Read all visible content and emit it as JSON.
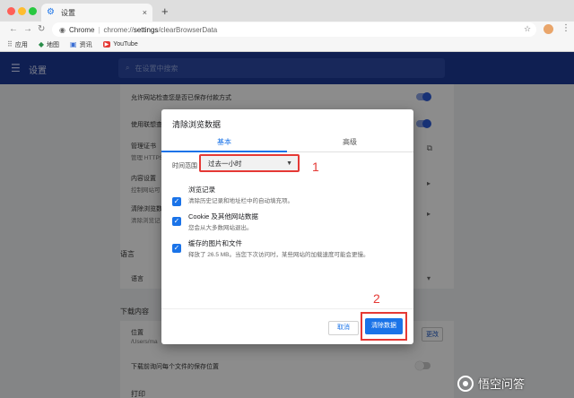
{
  "browser": {
    "tab_title": "设置",
    "tab_close": "×",
    "new_tab": "+",
    "nav": {
      "back": "←",
      "forward": "→",
      "reload": "↻"
    },
    "url_label": "Chrome",
    "url_sep": "|",
    "url_host": "chrome://",
    "url_path": "settings",
    "url_tail": "/clearBrowserData",
    "bookmarks": [
      {
        "icon": "apps-grid-icon",
        "label": "应用"
      },
      {
        "icon": "maps-pin-icon",
        "label": "地图"
      },
      {
        "icon": "news-icon",
        "label": "资讯"
      },
      {
        "icon": "youtube-icon",
        "label": "YouTube"
      }
    ]
  },
  "settings": {
    "title": "设置",
    "search_placeholder": "在设置中搜索",
    "rows": [
      {
        "label": "允许网站检查您是否已保存付款方式"
      },
      {
        "label": "使用联想查"
      },
      {
        "label": "管理证书",
        "sub": "管理 HTTPS"
      },
      {
        "label": "内容设置",
        "sub": "控制网站可"
      },
      {
        "label": "清除浏览数",
        "sub": "清除浏览记"
      }
    ],
    "language_section": "语言",
    "language_row": "语言",
    "download_section": "下载内容",
    "location_label": "位置",
    "location_path": "/Users/ma",
    "change_button": "更改",
    "ask_where": "下载前询问每个文件的保存位置",
    "print_section": "打印"
  },
  "dialog": {
    "title": "清除浏览数据",
    "tabs": [
      "基本",
      "高级"
    ],
    "time_range_label": "时间范围",
    "time_range_value": "过去一小时",
    "items": [
      {
        "label": "浏览记录",
        "desc": "清除历史记录和地址栏中的自动填充项。",
        "checked": true
      },
      {
        "label": "Cookie 及其他网站数据",
        "desc": "您会从大多数网站退出。",
        "checked": true
      },
      {
        "label": "缓存的图片和文件",
        "desc": "释放了 26.5 MB。当您下次访问时，某些网站的加载速度可能会更慢。",
        "checked": true
      }
    ],
    "cancel": "取消",
    "confirm": "清除数据"
  },
  "annotations": [
    "1",
    "2"
  ],
  "watermark": "悟空问答",
  "colors": {
    "accent": "#1a73e8",
    "annotation": "#e53935",
    "header": "#1c3a96"
  }
}
